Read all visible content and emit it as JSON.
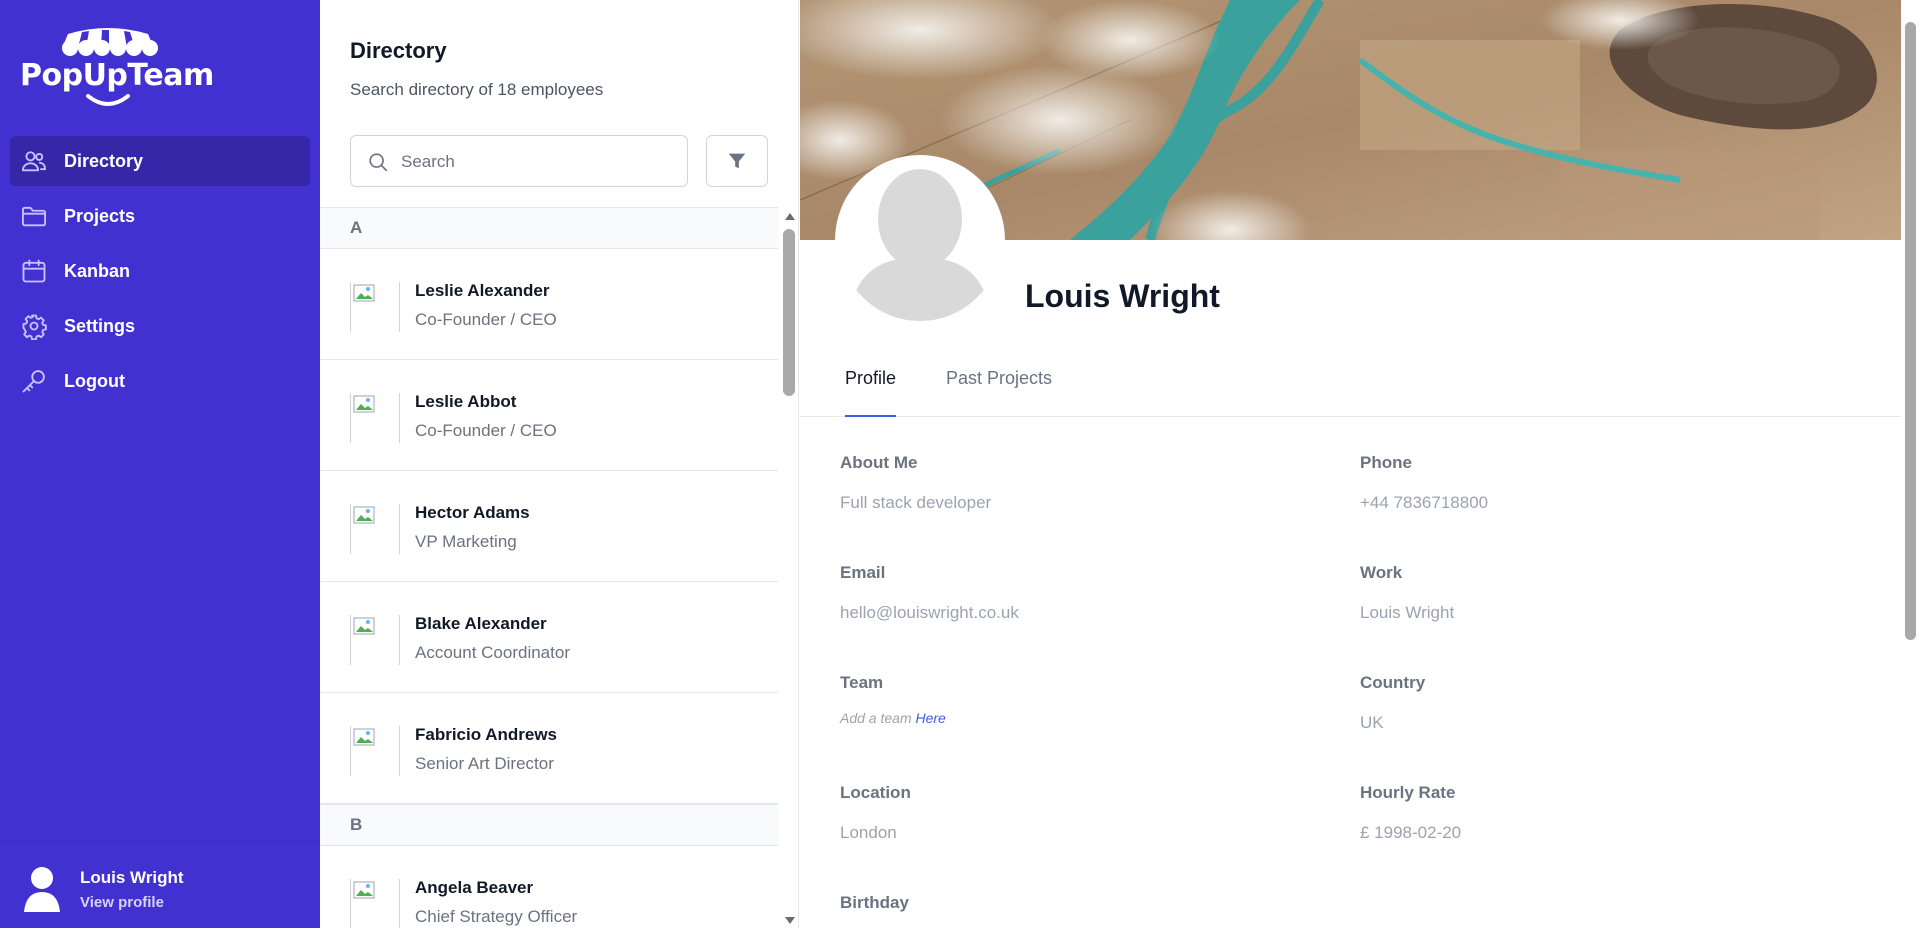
{
  "brand": {
    "name": "PopUpTeam"
  },
  "sidebar": {
    "items": [
      {
        "label": "Directory",
        "icon": "users-icon",
        "active": true
      },
      {
        "label": "Projects",
        "icon": "folder-icon"
      },
      {
        "label": "Kanban",
        "icon": "calendar-icon"
      },
      {
        "label": "Settings",
        "icon": "gear-icon"
      },
      {
        "label": "Logout",
        "icon": "key-icon"
      }
    ],
    "user": {
      "name": "Louis Wright",
      "link": "View profile"
    }
  },
  "directory": {
    "title": "Directory",
    "subtitle": "Search directory of 18 employees",
    "search_placeholder": "Search",
    "groups": [
      {
        "letter": "A",
        "people": [
          {
            "name": "Leslie Alexander",
            "role": "Co-Founder / CEO"
          },
          {
            "name": "Leslie Abbot",
            "role": "Co-Founder / CEO"
          },
          {
            "name": "Hector Adams",
            "role": "VP Marketing"
          },
          {
            "name": "Blake Alexander",
            "role": "Account Coordinator"
          },
          {
            "name": "Fabricio Andrews",
            "role": "Senior Art Director"
          }
        ]
      },
      {
        "letter": "B",
        "people": [
          {
            "name": "Angela Beaver",
            "role": "Chief Strategy Officer"
          }
        ]
      }
    ]
  },
  "profile": {
    "name": "Louis Wright",
    "tabs": [
      {
        "label": "Profile",
        "active": true
      },
      {
        "label": "Past Projects"
      }
    ],
    "fields": {
      "about_label": "About Me",
      "about_value": "Full stack developer",
      "phone_label": "Phone",
      "phone_value": "+44 7836718800",
      "email_label": "Email",
      "email_value": "hello@louiswright.co.uk",
      "work_label": "Work",
      "work_value": "Louis Wright",
      "team_label": "Team",
      "team_hint": "Add a team ",
      "team_link": "Here",
      "country_label": "Country",
      "country_value": "UK",
      "location_label": "Location",
      "location_value": "London",
      "rate_label": "Hourly Rate",
      "rate_value": "£ 1998-02-20",
      "birthday_label": "Birthday"
    }
  },
  "colors": {
    "sidebar": "#4131d1",
    "sidebar_active": "#3527a8",
    "accent": "#3b5fe0"
  }
}
